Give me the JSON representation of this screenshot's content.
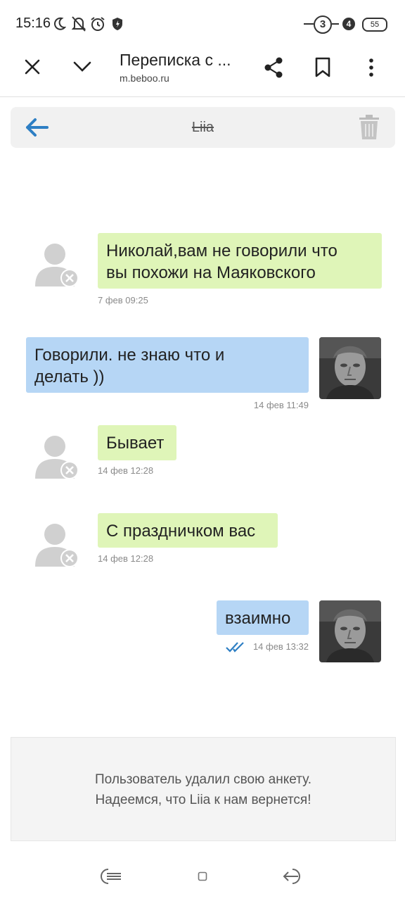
{
  "status_bar": {
    "time": "15:16",
    "sim_badge": "3",
    "signal_badge": "4",
    "battery": "55",
    "icons": [
      "moon-icon",
      "bell-off-icon",
      "alarm-icon",
      "shield-icon"
    ]
  },
  "toolbar": {
    "title": "Переписка с ...",
    "url": "m.beboo.ru",
    "icons": [
      "close-icon",
      "chevron-down-icon",
      "share-icon",
      "bookmark-icon",
      "more-vert-icon"
    ]
  },
  "chat": {
    "contact_name": "Liia",
    "icons": [
      "back-arrow-icon",
      "trash-icon"
    ]
  },
  "messages": [
    {
      "side": "in",
      "text_lines": [
        "Николай,вам не говорили что",
        "вы похожи на Маяковского"
      ],
      "time": "7 фев 09:25"
    },
    {
      "side": "out",
      "text_lines": [
        "Говорили. не знаю что и",
        "делать ))"
      ],
      "time": "14 фев 11:49"
    },
    {
      "side": "in",
      "text_lines": [
        "Бывает"
      ],
      "time": "14 фев 12:28"
    },
    {
      "side": "in",
      "text_lines": [
        "С праздничком вас"
      ],
      "time": "14 фев 12:28"
    },
    {
      "side": "out",
      "text_lines": [
        "взаимно"
      ],
      "time": "14 фев 13:32",
      "read": true
    }
  ],
  "notice": {
    "line1": "Пользователь удалил свою анкету.",
    "line2": "Надеемся, что Liia к нам вернется!"
  },
  "colors": {
    "incoming_bubble": "#dff5b8",
    "outgoing_bubble": "#b6d6f5",
    "accent": "#2e7fc4"
  },
  "nav_bar": {
    "icons": [
      "recents-icon",
      "home-icon",
      "back-icon"
    ]
  }
}
